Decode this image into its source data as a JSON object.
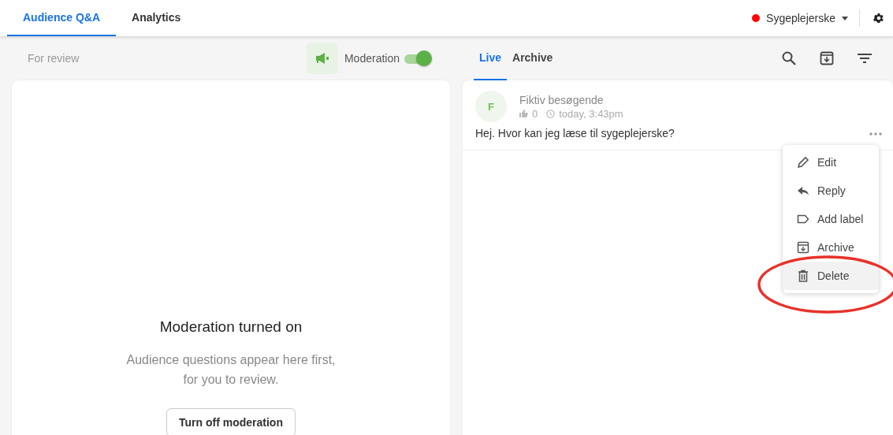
{
  "top_tabs": [
    {
      "label": "Audience Q&A",
      "selected": true
    },
    {
      "label": "Analytics",
      "selected": false
    }
  ],
  "event_name": "Sygeplejerske",
  "review_panel": {
    "title": "For review",
    "moderation": {
      "label": "Moderation",
      "on": true
    },
    "empty_title": "Moderation turned on",
    "empty_text": "Audience questions appear here first, for you to review.",
    "button": "Turn off moderation"
  },
  "questions_panel": {
    "tabs": [
      {
        "label": "Live",
        "selected": true
      },
      {
        "label": "Archive",
        "selected": false
      }
    ],
    "questions": [
      {
        "initial": "F",
        "author": "Fiktiv besøgende",
        "likes": "0",
        "time": "today, 3:43pm",
        "text": "Hej. Hvor kan jeg læse til sygeplejerske?"
      }
    ],
    "menu": [
      {
        "label": "Edit",
        "kind": "edit",
        "selected": false
      },
      {
        "label": "Reply",
        "kind": "reply",
        "selected": false
      },
      {
        "label": "Add label",
        "kind": "label",
        "selected": false
      },
      {
        "label": "Archive",
        "kind": "archive",
        "selected": false
      },
      {
        "label": "Delete",
        "kind": "delete",
        "selected": true
      }
    ]
  }
}
